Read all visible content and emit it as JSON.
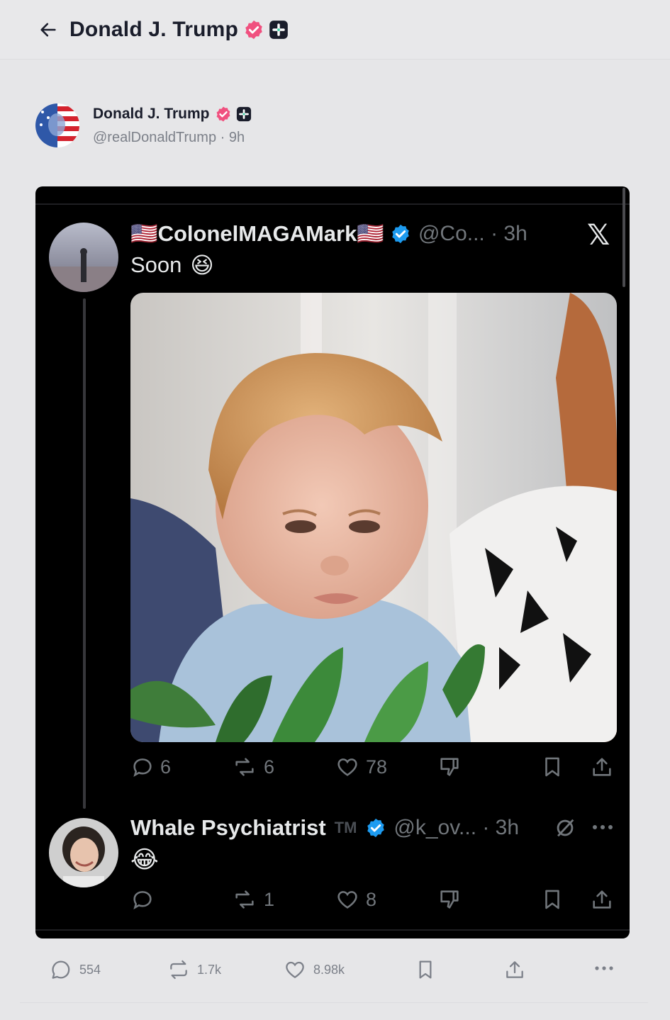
{
  "header": {
    "title": "Donald J. Trump",
    "back_icon": "arrow-left-icon"
  },
  "post": {
    "author_name": "Donald J. Trump",
    "author_handle_time": "@realDonaldTrump · 9h",
    "actions": {
      "replies": "554",
      "reposts": "1.7k",
      "likes": "8.98k"
    }
  },
  "screenshot": {
    "tweet1": {
      "name": "🇺🇸ColonelMAGAMark🇺🇸",
      "handle_time": "@Co... · 3h",
      "text": "Soon",
      "emoji": "😆",
      "replies": "6",
      "reposts": "6",
      "likes": "78"
    },
    "tweet2": {
      "name": "Whale Psychiatrist",
      "tm": "TM",
      "handle_time": "@k_ov... · 3h",
      "emoji": "😂",
      "reposts": "1",
      "likes": "8"
    },
    "x_logo": "𝕏"
  },
  "colors": {
    "verified_pink": "#f0507f",
    "blue_check": "#1d9bf0",
    "text_dark": "#1a1d2b",
    "muted": "#7c8089"
  }
}
